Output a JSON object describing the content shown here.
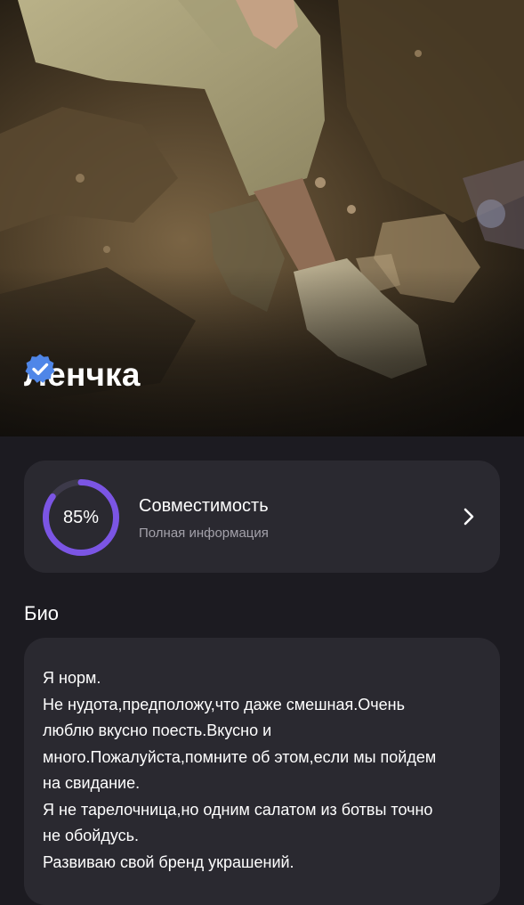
{
  "profile": {
    "name": "Ленчка",
    "verified_icon": "verified-badge-icon"
  },
  "compatibility": {
    "percent": 85,
    "percent_label": "85%",
    "title": "Совместимость",
    "subtitle": "Полная информация",
    "chevron_icon": "chevron-right-icon"
  },
  "bio": {
    "title": "Био",
    "lines": [
      "Я норм.",
      "Не нудота,предположу,что даже смешная.Очень",
      "люблю вкусно поесть.Вкусно и",
      "много.Пожалуйста,помните об этом,если мы пойдем",
      "на свидание.",
      "Я не тарелочница,но одним салатом из ботвы точно",
      "не обойдусь.",
      "Развиваю свой бренд украшений."
    ]
  },
  "colors": {
    "background": "#1c1b21",
    "card": "#2a2930",
    "accent_ring": "#7b55e4",
    "ring_track": "#3d3a4a",
    "verified": "#4f86e8",
    "muted_text": "#a3a1aa"
  }
}
